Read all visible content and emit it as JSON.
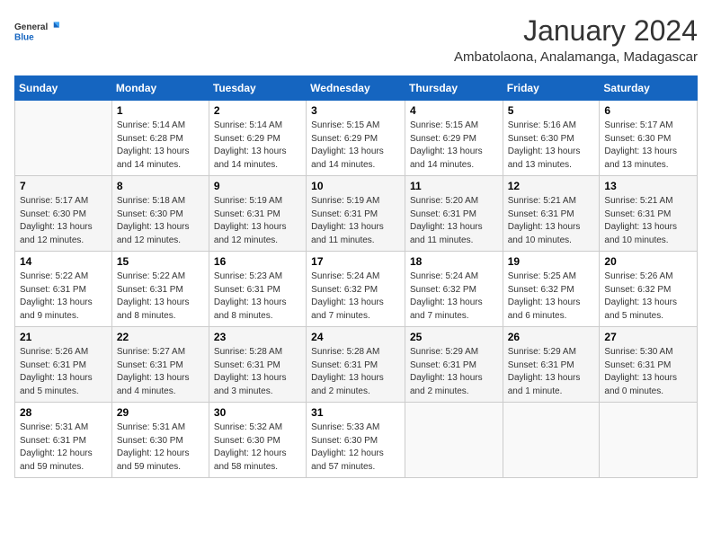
{
  "logo": {
    "line1": "General",
    "line2": "Blue"
  },
  "title": "January 2024",
  "location": "Ambatolaona, Analamanga, Madagascar",
  "days_header": [
    "Sunday",
    "Monday",
    "Tuesday",
    "Wednesday",
    "Thursday",
    "Friday",
    "Saturday"
  ],
  "weeks": [
    [
      {
        "day": "",
        "info": ""
      },
      {
        "day": "1",
        "info": "Sunrise: 5:14 AM\nSunset: 6:28 PM\nDaylight: 13 hours\nand 14 minutes."
      },
      {
        "day": "2",
        "info": "Sunrise: 5:14 AM\nSunset: 6:29 PM\nDaylight: 13 hours\nand 14 minutes."
      },
      {
        "day": "3",
        "info": "Sunrise: 5:15 AM\nSunset: 6:29 PM\nDaylight: 13 hours\nand 14 minutes."
      },
      {
        "day": "4",
        "info": "Sunrise: 5:15 AM\nSunset: 6:29 PM\nDaylight: 13 hours\nand 14 minutes."
      },
      {
        "day": "5",
        "info": "Sunrise: 5:16 AM\nSunset: 6:30 PM\nDaylight: 13 hours\nand 13 minutes."
      },
      {
        "day": "6",
        "info": "Sunrise: 5:17 AM\nSunset: 6:30 PM\nDaylight: 13 hours\nand 13 minutes."
      }
    ],
    [
      {
        "day": "7",
        "info": "Sunrise: 5:17 AM\nSunset: 6:30 PM\nDaylight: 13 hours\nand 12 minutes."
      },
      {
        "day": "8",
        "info": "Sunrise: 5:18 AM\nSunset: 6:30 PM\nDaylight: 13 hours\nand 12 minutes."
      },
      {
        "day": "9",
        "info": "Sunrise: 5:19 AM\nSunset: 6:31 PM\nDaylight: 13 hours\nand 12 minutes."
      },
      {
        "day": "10",
        "info": "Sunrise: 5:19 AM\nSunset: 6:31 PM\nDaylight: 13 hours\nand 11 minutes."
      },
      {
        "day": "11",
        "info": "Sunrise: 5:20 AM\nSunset: 6:31 PM\nDaylight: 13 hours\nand 11 minutes."
      },
      {
        "day": "12",
        "info": "Sunrise: 5:21 AM\nSunset: 6:31 PM\nDaylight: 13 hours\nand 10 minutes."
      },
      {
        "day": "13",
        "info": "Sunrise: 5:21 AM\nSunset: 6:31 PM\nDaylight: 13 hours\nand 10 minutes."
      }
    ],
    [
      {
        "day": "14",
        "info": "Sunrise: 5:22 AM\nSunset: 6:31 PM\nDaylight: 13 hours\nand 9 minutes."
      },
      {
        "day": "15",
        "info": "Sunrise: 5:22 AM\nSunset: 6:31 PM\nDaylight: 13 hours\nand 8 minutes."
      },
      {
        "day": "16",
        "info": "Sunrise: 5:23 AM\nSunset: 6:31 PM\nDaylight: 13 hours\nand 8 minutes."
      },
      {
        "day": "17",
        "info": "Sunrise: 5:24 AM\nSunset: 6:32 PM\nDaylight: 13 hours\nand 7 minutes."
      },
      {
        "day": "18",
        "info": "Sunrise: 5:24 AM\nSunset: 6:32 PM\nDaylight: 13 hours\nand 7 minutes."
      },
      {
        "day": "19",
        "info": "Sunrise: 5:25 AM\nSunset: 6:32 PM\nDaylight: 13 hours\nand 6 minutes."
      },
      {
        "day": "20",
        "info": "Sunrise: 5:26 AM\nSunset: 6:32 PM\nDaylight: 13 hours\nand 5 minutes."
      }
    ],
    [
      {
        "day": "21",
        "info": "Sunrise: 5:26 AM\nSunset: 6:31 PM\nDaylight: 13 hours\nand 5 minutes."
      },
      {
        "day": "22",
        "info": "Sunrise: 5:27 AM\nSunset: 6:31 PM\nDaylight: 13 hours\nand 4 minutes."
      },
      {
        "day": "23",
        "info": "Sunrise: 5:28 AM\nSunset: 6:31 PM\nDaylight: 13 hours\nand 3 minutes."
      },
      {
        "day": "24",
        "info": "Sunrise: 5:28 AM\nSunset: 6:31 PM\nDaylight: 13 hours\nand 2 minutes."
      },
      {
        "day": "25",
        "info": "Sunrise: 5:29 AM\nSunset: 6:31 PM\nDaylight: 13 hours\nand 2 minutes."
      },
      {
        "day": "26",
        "info": "Sunrise: 5:29 AM\nSunset: 6:31 PM\nDaylight: 13 hours\nand 1 minute."
      },
      {
        "day": "27",
        "info": "Sunrise: 5:30 AM\nSunset: 6:31 PM\nDaylight: 13 hours\nand 0 minutes."
      }
    ],
    [
      {
        "day": "28",
        "info": "Sunrise: 5:31 AM\nSunset: 6:31 PM\nDaylight: 12 hours\nand 59 minutes."
      },
      {
        "day": "29",
        "info": "Sunrise: 5:31 AM\nSunset: 6:30 PM\nDaylight: 12 hours\nand 59 minutes."
      },
      {
        "day": "30",
        "info": "Sunrise: 5:32 AM\nSunset: 6:30 PM\nDaylight: 12 hours\nand 58 minutes."
      },
      {
        "day": "31",
        "info": "Sunrise: 5:33 AM\nSunset: 6:30 PM\nDaylight: 12 hours\nand 57 minutes."
      },
      {
        "day": "",
        "info": ""
      },
      {
        "day": "",
        "info": ""
      },
      {
        "day": "",
        "info": ""
      }
    ]
  ]
}
